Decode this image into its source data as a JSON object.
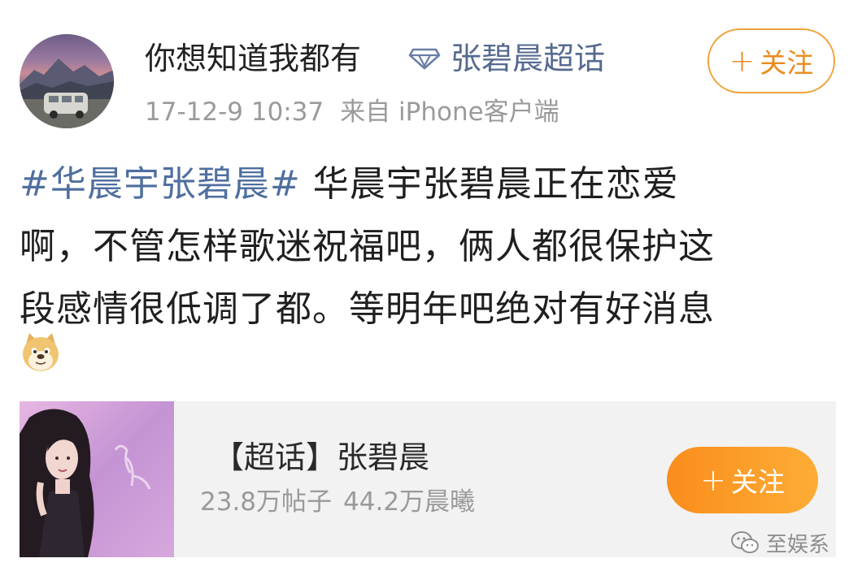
{
  "post": {
    "username": "你想知道我都有",
    "topic_link": "张碧晨超话",
    "timestamp": "17-12-9 10:37",
    "source": "来自 iPhone客户端",
    "follow_label": "关注",
    "lines": [
      {
        "hashtag": "#华晨宇张碧晨#",
        "text": " 华晨宇张碧晨正在恋爱"
      },
      {
        "text": "啊，不管怎样歌迷祝福吧，俩人都很保护这"
      },
      {
        "text": "段感情很低调了都。等明年吧绝对有好消息"
      }
    ],
    "emoji": "doge-emoji"
  },
  "card": {
    "title": "【超话】张碧晨",
    "posts_stat": "23.8万帖子",
    "fans_stat": "44.2万晨曦",
    "follow_label": "关注"
  },
  "watermark": {
    "text": "至娱系"
  },
  "colors": {
    "link": "#566a90",
    "hashtag": "#4f6f9f",
    "follow_outline": "#f0a23a",
    "follow_fill": "#fb8d1c",
    "meta_gray": "#9a9a9a",
    "card_bg": "#f2f2f2"
  }
}
